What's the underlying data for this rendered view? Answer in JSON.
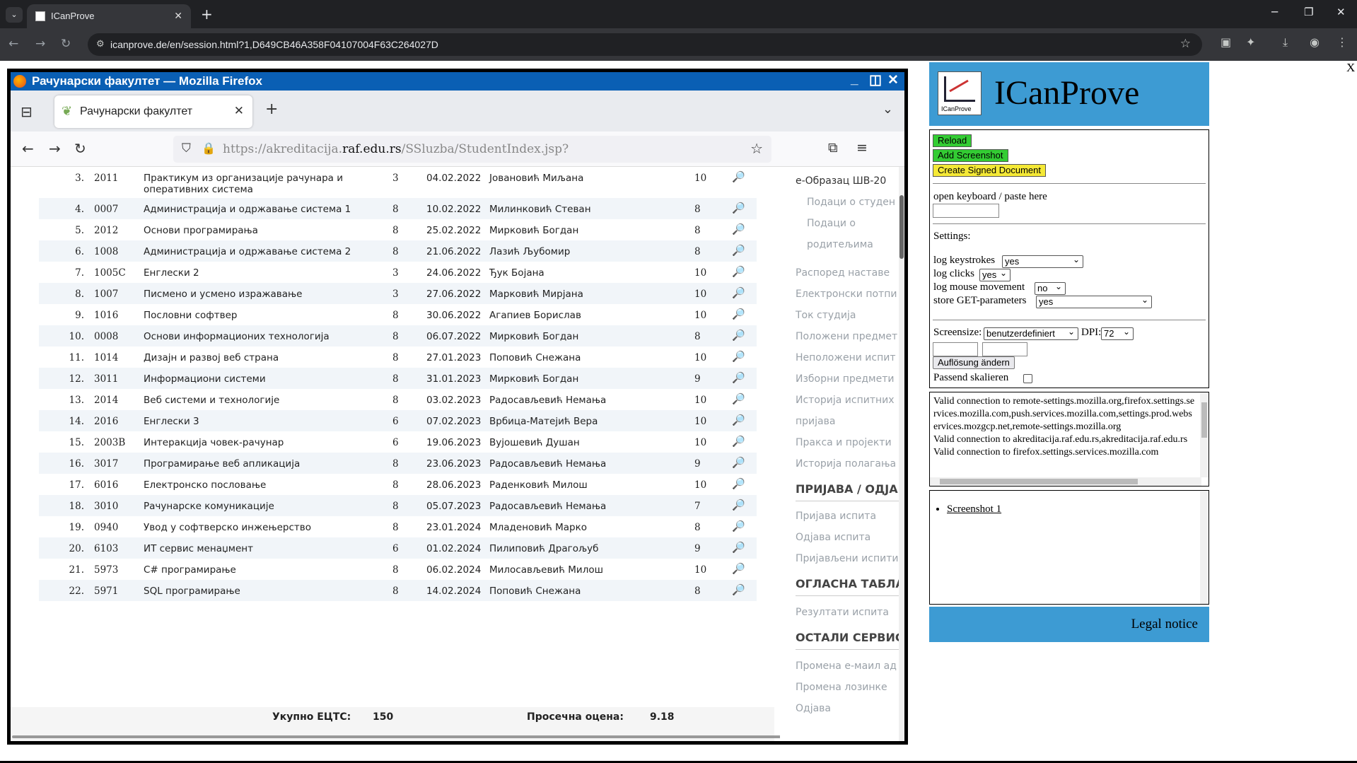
{
  "chrome": {
    "tab_title": "ICanProve",
    "url": "icanprove.de/en/session.html?1,D649CB46A358F04107004F63C264027D"
  },
  "remote": {
    "window_title": "Рачунарски факултет — Mozilla Firefox",
    "tab_label": "Рачунарски факултет",
    "url_prefix": "https://akreditacija.",
    "url_domain": "raf.edu.rs",
    "url_path": "/SSluzba/StudentIndex.jsp?",
    "rows": [
      {
        "no": "3.",
        "code": "2011",
        "name": "Практикум из организације рачунара и оперативних система",
        "ects": "3",
        "date": "04.02.2022",
        "prof": "Јовановић Миљана",
        "grade": "10"
      },
      {
        "no": "4.",
        "code": "0007",
        "name": "Администрација и одржавање система 1",
        "ects": "8",
        "date": "10.02.2022",
        "prof": "Милинковић Стеван",
        "grade": "8"
      },
      {
        "no": "5.",
        "code": "2012",
        "name": "Основи програмирања",
        "ects": "8",
        "date": "25.02.2022",
        "prof": "Мирковић Богдан",
        "grade": "8"
      },
      {
        "no": "6.",
        "code": "1008",
        "name": "Администрација и одржавање система 2",
        "ects": "8",
        "date": "21.06.2022",
        "prof": "Лазић Љубомир",
        "grade": "8"
      },
      {
        "no": "7.",
        "code": "1005C",
        "name": "Енглески 2",
        "ects": "3",
        "date": "24.06.2022",
        "prof": "Ђук Бојана",
        "grade": "10"
      },
      {
        "no": "8.",
        "code": "1007",
        "name": "Писмено и усмено изражавање",
        "ects": "3",
        "date": "27.06.2022",
        "prof": "Марковић Мирјана",
        "grade": "10"
      },
      {
        "no": "9.",
        "code": "1016",
        "name": "Пословни софтвер",
        "ects": "8",
        "date": "30.06.2022",
        "prof": "Агапиев Борислав",
        "grade": "10"
      },
      {
        "no": "10.",
        "code": "0008",
        "name": "Основи информационих технологија",
        "ects": "8",
        "date": "06.07.2022",
        "prof": "Мирковић Богдан",
        "grade": "8"
      },
      {
        "no": "11.",
        "code": "1014",
        "name": "Дизајн и развој веб страна",
        "ects": "8",
        "date": "27.01.2023",
        "prof": "Поповић Снежана",
        "grade": "10"
      },
      {
        "no": "12.",
        "code": "3011",
        "name": "Информациони системи",
        "ects": "8",
        "date": "31.01.2023",
        "prof": "Мирковић Богдан",
        "grade": "9"
      },
      {
        "no": "13.",
        "code": "2014",
        "name": "Веб системи и технологије",
        "ects": "8",
        "date": "03.02.2023",
        "prof": "Радосављевић Немања",
        "grade": "10"
      },
      {
        "no": "14.",
        "code": "2016",
        "name": "Енглески 3",
        "ects": "6",
        "date": "07.02.2023",
        "prof": "Врбица-Матејић Вера",
        "grade": "10"
      },
      {
        "no": "15.",
        "code": "2003B",
        "name": "Интеракција човек-рачунар",
        "ects": "6",
        "date": "19.06.2023",
        "prof": "Вујошевић Душан",
        "grade": "10"
      },
      {
        "no": "16.",
        "code": "3017",
        "name": "Програмирање веб апликација",
        "ects": "8",
        "date": "23.06.2023",
        "prof": "Радосављевић Немања",
        "grade": "9"
      },
      {
        "no": "17.",
        "code": "6016",
        "name": "Електронско пословање",
        "ects": "8",
        "date": "28.06.2023",
        "prof": "Раденковић Милош",
        "grade": "10"
      },
      {
        "no": "18.",
        "code": "3010",
        "name": "Рачунарске комуникације",
        "ects": "8",
        "date": "05.07.2023",
        "prof": "Радосављевић Немања",
        "grade": "7"
      },
      {
        "no": "19.",
        "code": "0940",
        "name": "Увод у софтверско инжењерство",
        "ects": "8",
        "date": "23.01.2024",
        "prof": "Младеновић Марко",
        "grade": "8"
      },
      {
        "no": "20.",
        "code": "6103",
        "name": "ИТ сервис менаџмент",
        "ects": "6",
        "date": "01.02.2024",
        "prof": "Пилиповић Драгољуб",
        "grade": "9"
      },
      {
        "no": "21.",
        "code": "5973",
        "name": "C# програмирање",
        "ects": "8",
        "date": "06.02.2024",
        "prof": "Милосављевић Милош",
        "grade": "10"
      },
      {
        "no": "22.",
        "code": "5971",
        "name": "SQL програмирање",
        "ects": "8",
        "date": "14.02.2024",
        "prof": "Поповић Снежана",
        "grade": "8"
      }
    ],
    "totals": {
      "ects_label": "Укупно ЕЦТС:",
      "ects_value": "150",
      "avg_label": "Просечна оцена:",
      "avg_value": "9.18"
    },
    "sidebar": {
      "form": "е-Образац ШВ-20",
      "student_data": "Подаци о студен",
      "parent_data_1": "Подаци о",
      "parent_data_2": "родитељима",
      "schedule": "Распоред наставе",
      "e_docs": "Електронски потпи",
      "study_flow": "Ток студија",
      "passed": "Положени предмет",
      "failed": "Неположени испит",
      "electives": "Изборни предмети",
      "exam_history_1": "Историја испитних",
      "exam_history_2": "пријава",
      "practice": "Пракса и пројекти",
      "pass_history": "Историја полагања",
      "head_register": "ПРИЈАВА / ОДЈАВ",
      "register": "Пријава испита",
      "unregister": "Одјава испита",
      "registered": "Пријављени испити",
      "head_board": "ОГЛАСНА ТАБЛА",
      "results": "Резултати испита",
      "head_other": "ОСТАЛИ СЕРВИС",
      "change_email": "Промена е-маил ад",
      "change_password": "Промена лозинке",
      "logout": "Одјава"
    }
  },
  "icanprove": {
    "title": "ICanProve",
    "logo_caption": "ICanProve",
    "reload": "Reload",
    "add_screenshot": "Add Screenshot",
    "create_signed": "Create Signed Document",
    "keyboard_label": "open keyboard / paste here",
    "settings_label": "Settings:",
    "log_keystrokes_label": "log keystrokes",
    "log_keystrokes_value": "yes",
    "log_clicks_label": "log clicks",
    "log_clicks_value": "yes",
    "log_mouse_label": "log mouse movement",
    "log_mouse_value": "no",
    "store_get_label": "store GET-parameters",
    "store_get_value": "yes",
    "screensize_label": "Screensize:",
    "screensize_value": "benutzerdefiniert",
    "dpi_label": "DPI:",
    "dpi_value": "72",
    "change_resolution": "Auflösung ändern",
    "fit_scaled": "Passend skalieren",
    "log_text": "Valid connection to remote-settings.mozilla.org,firefox.settings.services.mozilla.com,push.services.mozilla.com,settings.prod.webservices.mozgcp.net,remote-settings.mozilla.org\nValid connection to akreditacija.raf.edu.rs,akreditacija.raf.edu.rs\nValid connection to firefox.settings.services.mozilla.com",
    "screenshots": [
      "Screenshot 1"
    ],
    "legal": "Legal notice",
    "close": "X"
  }
}
